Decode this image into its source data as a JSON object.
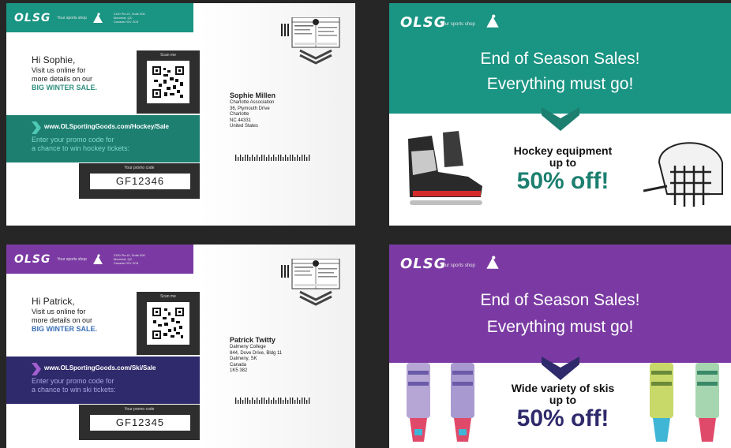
{
  "brand": {
    "logo": "OLSG",
    "tagline": "Your sports shop"
  },
  "colors": {
    "background": "#262626",
    "hockey": "#1a9483",
    "hockey_band": "#1c7f70",
    "ski": "#7b3aa3",
    "ski_band": "#2f2a6b",
    "hockey_text": "#2e8f7e",
    "ski_text": "#3a6fb5"
  },
  "postcards": [
    {
      "sender_address": "2100 Pie-IX, Suite 500\nMontréal, QC\nCanada H1V 2C8",
      "greeting": "Hi Sophie,",
      "line1": "Visit us online for",
      "line2": "more details on our",
      "sale": "BIG WINTER SALE.",
      "scan_label": "Scan me",
      "url": "www.OLSportingGoods.com/Hockey/Sale",
      "promo_line1": "Enter your promo code for",
      "promo_line2": "a chance to win hockey tickets:",
      "code_label": "Your promo code",
      "code": "GF12346",
      "recipient": {
        "name": "Sophie Millen",
        "line1": "Charlotte Association",
        "line2": "36, Plymouth Drive",
        "line3": "Charlotte",
        "line4": "NC 44331",
        "line5": "United States"
      }
    },
    {
      "sender_address": "2100 Pie-IX, Suite 500\nMontréal, QC\nCanada H1V 2C8",
      "greeting": "Hi Patrick,",
      "line1": "Visit us online for",
      "line2": "more details on our",
      "sale": "BIG WINTER SALE.",
      "scan_label": "Scan me",
      "url": "www.OLSportingGoods.com/Ski/Sale",
      "promo_line1": "Enter your promo code for",
      "promo_line2": "a chance to win ski tickets:",
      "code_label": "Your promo code",
      "code": "GF12345",
      "recipient": {
        "name": "Patrick Twitty",
        "line1": "Dalmeny College",
        "line2": "844, Dove Drive, Bldg 11",
        "line3": "Dalmeny, SK",
        "line4": "Canada",
        "line5": "1K5 382"
      }
    }
  ],
  "fronts": [
    {
      "title1": "End of Season Sales!",
      "title2": "Everything must go!",
      "headline1": "Hockey equipment",
      "headline2": "up to",
      "discount": "50% off!"
    },
    {
      "title1": "End of Season Sales!",
      "title2": "Everything must go!",
      "headline1": "Wide variety of skis",
      "headline2": "up to",
      "discount": "50% off!"
    }
  ]
}
